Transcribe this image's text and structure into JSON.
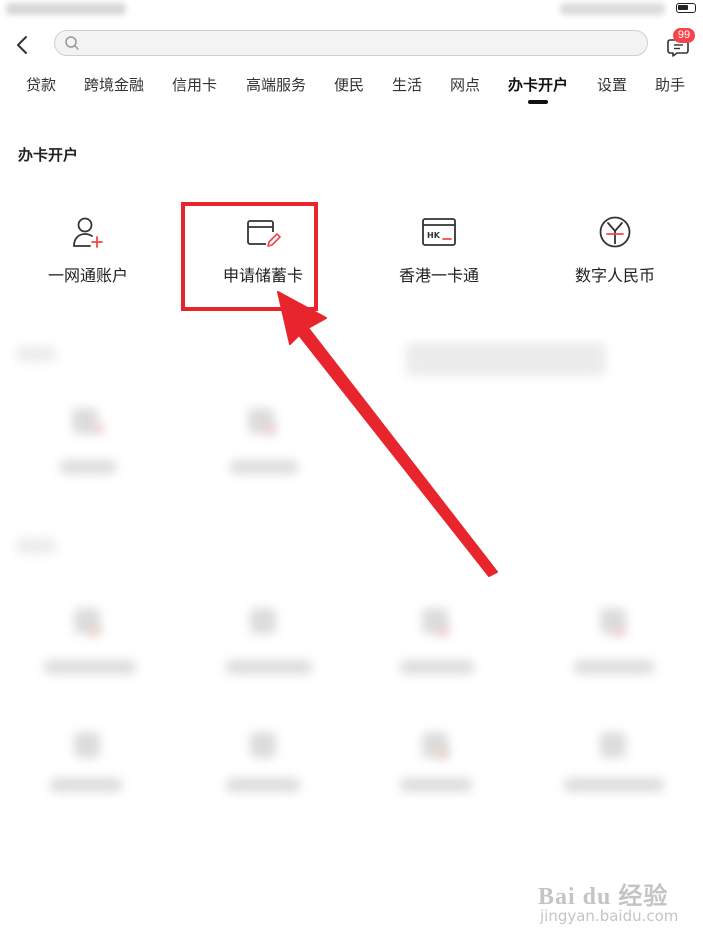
{
  "search": {
    "placeholder": ""
  },
  "notifications": {
    "badge": "99"
  },
  "tabs": [
    {
      "label": "贷款"
    },
    {
      "label": "跨境金融"
    },
    {
      "label": "信用卡"
    },
    {
      "label": "高端服务"
    },
    {
      "label": "便民"
    },
    {
      "label": "生活"
    },
    {
      "label": "网点"
    },
    {
      "label": "办卡开户",
      "active": true
    },
    {
      "label": "设置"
    },
    {
      "label": "助手"
    }
  ],
  "section": {
    "title": "办卡开户"
  },
  "services": [
    {
      "label": "一网通账户",
      "icon": "user-add-icon"
    },
    {
      "label": "申请储蓄卡",
      "icon": "card-edit-icon"
    },
    {
      "label": "香港一卡通",
      "icon": "hk-card-icon"
    },
    {
      "label": "数字人民币",
      "icon": "digital-rmb-icon"
    }
  ],
  "colors": {
    "accent": "#f5454a",
    "highlight": "#e8242c",
    "text": "#222222"
  },
  "watermark": {
    "logo": "Bai du 经验",
    "sub": "jingyan.baidu.com"
  }
}
